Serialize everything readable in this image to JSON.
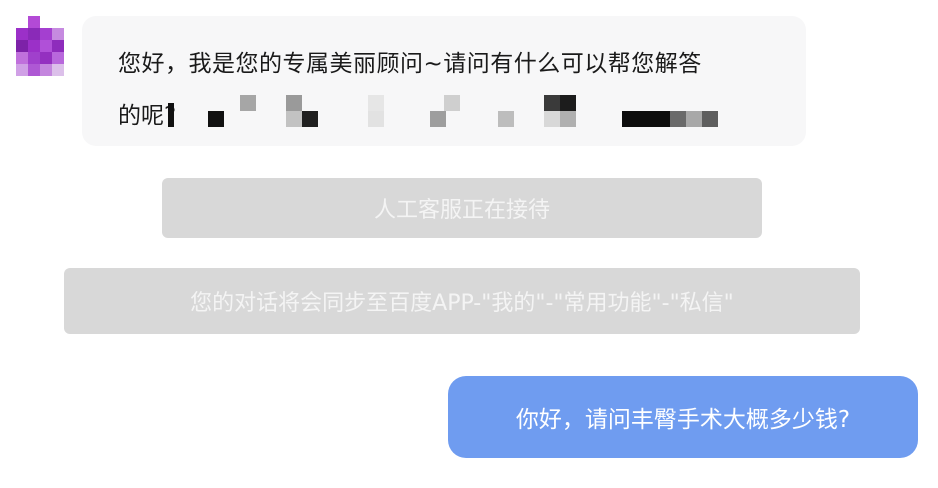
{
  "chat": {
    "assistant_message": {
      "line1": "您好，我是您的专属美丽顾问~请问有什么可以帮您解答",
      "line2": "的呢?"
    },
    "system_notice_agent": "人工客服正在接待",
    "system_notice_sync": "您的对话将会同步至百度APP-\"我的\"-\"常用功能\"-\"私信\"",
    "user_message": "你好，请问丰臀手术大概多少钱?"
  },
  "colors": {
    "assistant_bubble": "#f7f7f8",
    "notice_background": "#d8d8d8",
    "notice_text": "#f4f4f4",
    "user_bubble": "#6f9cf0",
    "avatar_purple": "#9b30c8"
  }
}
